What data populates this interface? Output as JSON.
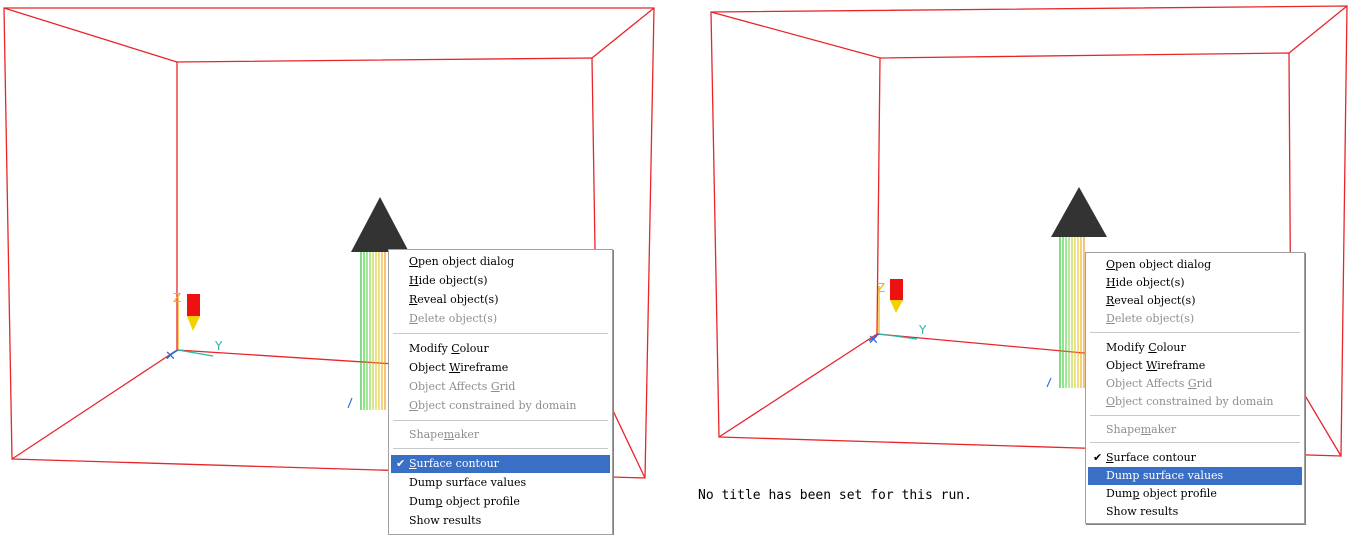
{
  "colors": {
    "box_edge": "#e8262a",
    "arrow_head": "#333333",
    "menu_highlight": "#3a6fc6",
    "axis_y": "#21b9a8",
    "axis_x": "#2e6bd8",
    "axis_z": "#f0b000"
  },
  "axis_labels": {
    "y": "Y",
    "z": "Z"
  },
  "views": [
    {
      "menu": {
        "items": [
          {
            "label": "Open object dialog",
            "key": "O",
            "enabled": true,
            "checked": false,
            "highlighted": false
          },
          {
            "label": "Hide object(s)",
            "key": "H",
            "enabled": true,
            "checked": false,
            "highlighted": false
          },
          {
            "label": "Reveal object(s)",
            "key": "R",
            "enabled": true,
            "checked": false,
            "highlighted": false
          },
          {
            "label": "Delete object(s)",
            "key": "D",
            "enabled": false,
            "checked": false,
            "highlighted": false
          },
          {
            "separator": true
          },
          {
            "label": "Modify Colour",
            "key": "C",
            "enabled": true,
            "checked": false,
            "highlighted": false
          },
          {
            "label": "Object Wireframe",
            "key": "W",
            "enabled": true,
            "checked": false,
            "highlighted": false
          },
          {
            "label": "Object Affects Grid",
            "key": "G",
            "enabled": false,
            "checked": false,
            "highlighted": false
          },
          {
            "label": "Object constrained by domain",
            "key": "O",
            "enabled": false,
            "checked": false,
            "highlighted": false
          },
          {
            "separator": true
          },
          {
            "label": "Shapemaker",
            "key": "m",
            "enabled": false,
            "checked": false,
            "highlighted": false
          },
          {
            "separator": true
          },
          {
            "label": "Surface contour",
            "key": "S",
            "enabled": true,
            "checked": true,
            "highlighted": true
          },
          {
            "label": "Dump surface values",
            "key": "",
            "enabled": true,
            "checked": false,
            "highlighted": false
          },
          {
            "label": "Dump object profile",
            "key": "p",
            "enabled": true,
            "checked": false,
            "highlighted": false
          },
          {
            "label": "Show results",
            "key": "",
            "enabled": true,
            "checked": false,
            "highlighted": false
          }
        ]
      }
    },
    {
      "menu": {
        "items": [
          {
            "label": "Open object dialog",
            "key": "O",
            "enabled": true,
            "checked": false,
            "highlighted": false
          },
          {
            "label": "Hide object(s)",
            "key": "H",
            "enabled": true,
            "checked": false,
            "highlighted": false
          },
          {
            "label": "Reveal object(s)",
            "key": "R",
            "enabled": true,
            "checked": false,
            "highlighted": false
          },
          {
            "label": "Delete object(s)",
            "key": "D",
            "enabled": false,
            "checked": false,
            "highlighted": false
          },
          {
            "separator": true
          },
          {
            "label": "Modify Colour",
            "key": "C",
            "enabled": true,
            "checked": false,
            "highlighted": false
          },
          {
            "label": "Object Wireframe",
            "key": "W",
            "enabled": true,
            "checked": false,
            "highlighted": false
          },
          {
            "label": "Object Affects Grid",
            "key": "G",
            "enabled": false,
            "checked": false,
            "highlighted": false
          },
          {
            "label": "Object constrained by domain",
            "key": "O",
            "enabled": false,
            "checked": false,
            "highlighted": false
          },
          {
            "separator": true
          },
          {
            "label": "Shapemaker",
            "key": "m",
            "enabled": false,
            "checked": false,
            "highlighted": false
          },
          {
            "separator": true
          },
          {
            "label": "Surface contour",
            "key": "S",
            "enabled": true,
            "checked": true,
            "highlighted": false
          },
          {
            "label": "Dump surface values",
            "key": "",
            "enabled": true,
            "checked": false,
            "highlighted": true
          },
          {
            "label": "Dump object profile",
            "key": "p",
            "enabled": true,
            "checked": false,
            "highlighted": false
          },
          {
            "label": "Show results",
            "key": "",
            "enabled": true,
            "checked": false,
            "highlighted": false
          }
        ]
      }
    }
  ],
  "status": {
    "title_message": "No title has been set for this run."
  }
}
